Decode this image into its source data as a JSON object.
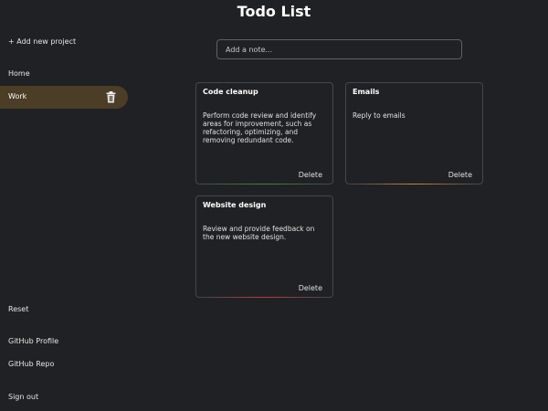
{
  "app": {
    "title": "Todo List"
  },
  "sidebar": {
    "add_project": "+ Add new project",
    "home": "Home",
    "projects": [
      {
        "label": "Work",
        "active": true,
        "icon": "trash-icon"
      }
    ],
    "reset": "Reset",
    "github_profile": "GitHub Profile",
    "github_repo": "GitHub Repo",
    "sign_out": "Sign out"
  },
  "note_input": {
    "placeholder": "Add a note..."
  },
  "notes": [
    {
      "title": "Code cleanup",
      "body": "Perform code review and identify areas for improvement, such as refactoring, optimizing, and removing redundant code.",
      "delete_label": "Delete",
      "accent_color": "#3f8a3f"
    },
    {
      "title": "Emails",
      "body": "Reply to emails",
      "delete_label": "Delete",
      "accent_color": "#c9892d"
    },
    {
      "title": "Website design",
      "body": "Review and provide feedback on the new website design.",
      "delete_label": "Delete",
      "accent_color": "#c23a3a"
    }
  ],
  "colors": {
    "background": "#202124",
    "active_project": "#4b3d26",
    "card_border": "#45474c"
  }
}
